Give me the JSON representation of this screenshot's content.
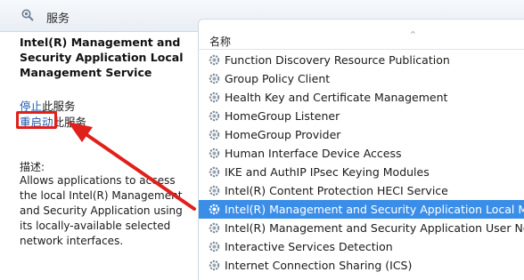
{
  "header": {
    "title": "服务",
    "icon": "gear-search-icon"
  },
  "left_pane": {
    "service_name": "Intel(R) Management and Security Application Local Management Service",
    "actions": {
      "stop_link": "停止",
      "stop_suffix": "此服务",
      "restart_link": "重启动",
      "restart_suffix": "此服务"
    },
    "description_label": "描述:",
    "description": "Allows applications to access the local Intel(R) Management and Security Application using its locally-available selected network interfaces."
  },
  "list": {
    "column_name": "名称",
    "sort_indicator": "^",
    "rows": [
      {
        "label": "Function Discovery Resource Publication"
      },
      {
        "label": "Group Policy Client"
      },
      {
        "label": "Health Key and Certificate Management"
      },
      {
        "label": "HomeGroup Listener"
      },
      {
        "label": "HomeGroup Provider"
      },
      {
        "label": "Human Interface Device Access"
      },
      {
        "label": "IKE and AuthIP IPsec Keying Modules"
      },
      {
        "label": "Intel(R) Content Protection HECI Service"
      },
      {
        "label": "Intel(R) Management and Security Application Local Mana",
        "selected": true
      },
      {
        "label": "Intel(R) Management and Security Application User Notific"
      },
      {
        "label": "Interactive Services Detection"
      },
      {
        "label": "Internet Connection Sharing (ICS)"
      }
    ]
  },
  "colors": {
    "selection": "#3b8ee8",
    "annotation": "#e0201a",
    "link": "#1a56b0"
  }
}
